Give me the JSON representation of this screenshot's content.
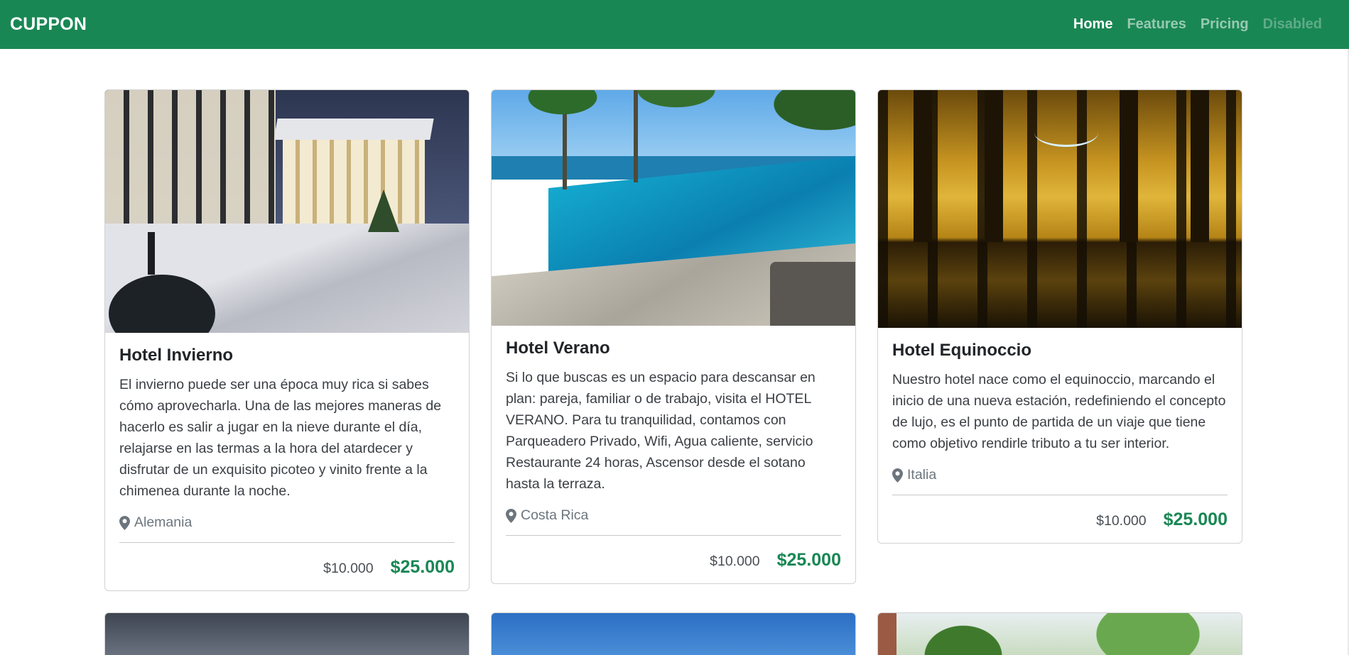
{
  "navbar": {
    "brand": "CUPPON",
    "links": [
      {
        "label": "Home",
        "state": "active"
      },
      {
        "label": "Features",
        "state": "default"
      },
      {
        "label": "Pricing",
        "state": "default"
      },
      {
        "label": "Disabled",
        "state": "disabled"
      }
    ]
  },
  "colors": {
    "primary": "#198754",
    "text": "#212529",
    "muted": "#6c757d"
  },
  "cards": [
    {
      "title": "Hotel Invierno",
      "description": "El invierno puede ser una época muy rica si sabes cómo aprovecharla. Una de las mejores maneras de hacerlo es salir a jugar en la nieve durante el día, relajarse en las termas a la hora del atardecer y disfrutar de un exquisito picoteo y vinito frente a la chimenea durante la noche.",
      "location": "Alemania",
      "old_price": "$10.000",
      "price": "$25.000",
      "image": "winter-hotel-night-snow"
    },
    {
      "title": "Hotel Verano",
      "description": "Si lo que buscas es un espacio para descansar en plan: pareja, familiar o de trabajo, visita el HOTEL VERANO. Para tu tranquilidad, contamos con Parqueadero Privado, Wifi, Agua caliente, servicio Restaurante 24 horas, Ascensor desde el sotano hasta la terraza.",
      "location": "Costa Rica",
      "old_price": "$10.000",
      "price": "$25.000",
      "image": "resort-pool-palm-trees"
    },
    {
      "title": "Hotel Equinoccio",
      "description": "Nuestro hotel nace como el equinoccio, marcando el inicio de una nueva estación, redefiniendo el concepto de lujo, es el punto de partida de un viaje que tiene como objetivo rendirle tributo a tu ser interior.",
      "location": "Italia",
      "old_price": "$10.000",
      "price": "$25.000",
      "image": "golden-atrium-reflection"
    }
  ]
}
